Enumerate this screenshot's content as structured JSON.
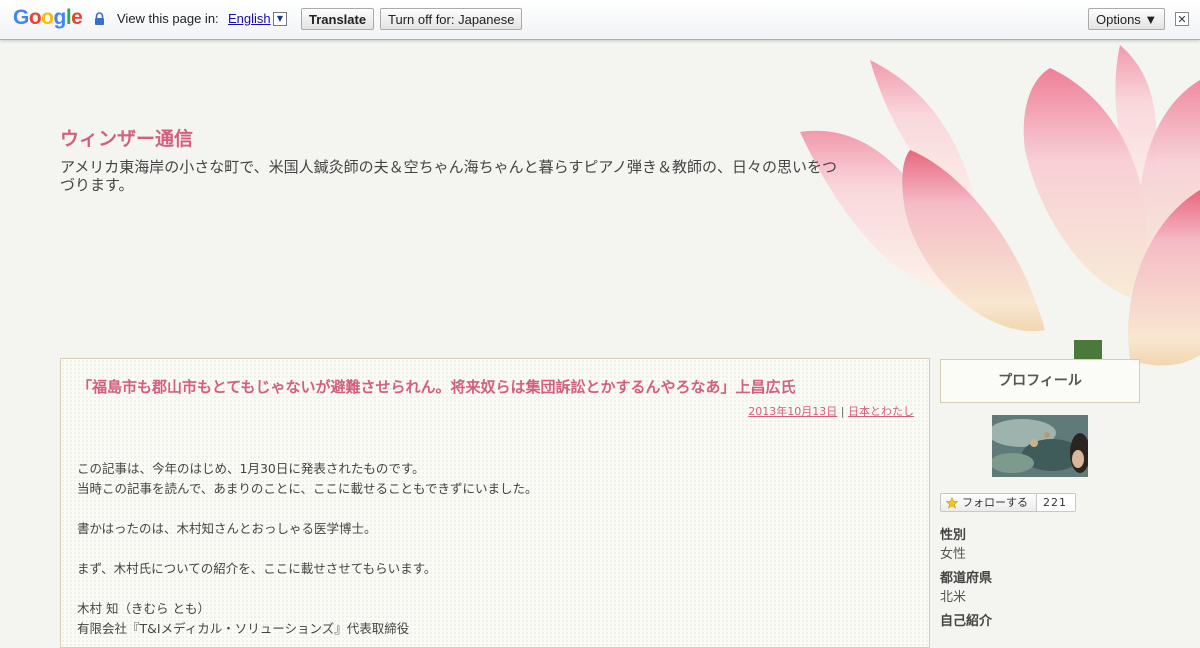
{
  "translate_bar": {
    "logo": "Google",
    "prompt": "View this page in:",
    "language": "English",
    "translate_button": "Translate",
    "turn_off_button": "Turn off for: Japanese",
    "options_button": "Options ▼",
    "close": "✕"
  },
  "blog": {
    "title": "ウィンザー通信",
    "description": "アメリカ東海岸の小さな町で、米国人鍼灸師の夫＆空ちゃん海ちゃんと暮らすピアノ弾き＆教師の、日々の思いをつづります。"
  },
  "post": {
    "title": "「福島市も郡山市もとてもじゃないが避難させられん。将来奴らは集団訴訟とかするんやろなあ」上昌広氏",
    "date": "2013年10月13日",
    "separator": "|",
    "category": "日本とわたし",
    "paragraphs": [
      [
        "この記事は、今年のはじめ、1月30日に発表されたものです。",
        "当時この記事を読んで、あまりのことに、ここに載せることもできずにいました。"
      ],
      [
        "書かはったのは、木村知さんとおっしゃる医学博士。"
      ],
      [
        "まず、木村氏についての紹介を、ここに載せさせてもらいます。"
      ],
      [
        "木村 知（きむら とも）",
        "有限会社『T&Iメディカル・ソリューションズ』代表取締役"
      ]
    ]
  },
  "sidebar": {
    "profile_heading": "プロフィール",
    "follow_label": "フォローする",
    "follow_count": "221",
    "fields": [
      {
        "label": "性別",
        "value": "女性"
      },
      {
        "label": "都道府県",
        "value": "北米"
      },
      {
        "label": "自己紹介",
        "value": ""
      }
    ]
  },
  "colors": {
    "accent": "#d2607c",
    "text": "#444444",
    "background": "#f4f4f0",
    "border": "#d6ceb4"
  }
}
